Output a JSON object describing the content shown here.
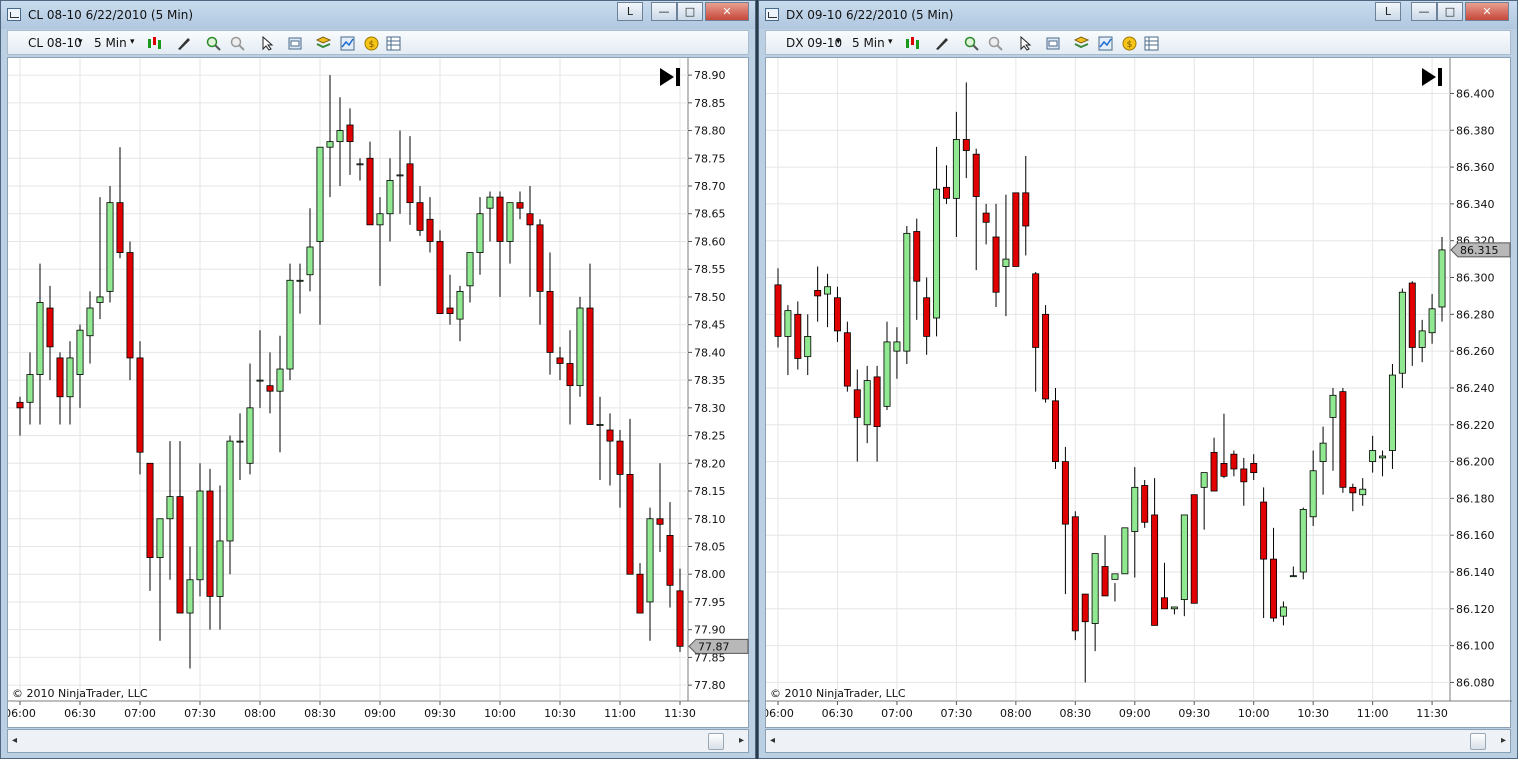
{
  "windows": [
    {
      "title": "CL 08-10  6/22/2010 (5 Min)",
      "buttons": {
        "l": "L",
        "min": "—",
        "max": "□",
        "close": "✕"
      },
      "toolbar": {
        "instrument": "CL 08-10",
        "interval": "5 Min"
      },
      "scroll": {
        "left": "◂",
        "right": "▸"
      },
      "copyright": "© 2010 NinjaTrader, LLC",
      "colors": {
        "up": "#90e890",
        "down": "#e00000",
        "grid": "#e6e6e6",
        "price_marker": "#b8b8b8"
      },
      "chart_data": {
        "type": "candlestick",
        "price_label": "77.87",
        "ylim": [
          77.775,
          78.92
        ],
        "y_ticks": [
          "78.90",
          "78.85",
          "78.80",
          "78.75",
          "78.70",
          "78.65",
          "78.60",
          "78.55",
          "78.50",
          "78.45",
          "78.40",
          "78.35",
          "78.30",
          "78.25",
          "78.20",
          "78.15",
          "78.10",
          "78.05",
          "78.00",
          "77.95",
          "77.90",
          "77.85",
          "77.80"
        ],
        "x_ticks": [
          "06:00",
          "06:30",
          "07:00",
          "07:30",
          "08:00",
          "08:30",
          "09:00",
          "09:30",
          "10:00",
          "10:30",
          "11:00",
          "11:30"
        ],
        "candles": [
          [
            78.31,
            78.32,
            78.25,
            78.3
          ],
          [
            78.31,
            78.4,
            78.27,
            78.36
          ],
          [
            78.36,
            78.56,
            78.27,
            78.49
          ],
          [
            78.48,
            78.52,
            78.35,
            78.41
          ],
          [
            78.39,
            78.4,
            78.27,
            78.32
          ],
          [
            78.32,
            78.42,
            78.27,
            78.39
          ],
          [
            78.36,
            78.45,
            78.3,
            78.44
          ],
          [
            78.43,
            78.51,
            78.38,
            78.48
          ],
          [
            78.49,
            78.68,
            78.46,
            78.5
          ],
          [
            78.51,
            78.7,
            78.49,
            78.67
          ],
          [
            78.67,
            78.77,
            78.57,
            78.58
          ],
          [
            78.58,
            78.6,
            78.35,
            78.39
          ],
          [
            78.39,
            78.42,
            78.18,
            78.22
          ],
          [
            78.2,
            78.2,
            77.97,
            78.03
          ],
          [
            78.03,
            78.07,
            77.88,
            78.1
          ],
          [
            78.1,
            78.24,
            77.99,
            78.14
          ],
          [
            78.14,
            78.24,
            77.93,
            77.93
          ],
          [
            77.93,
            78.05,
            77.83,
            77.99
          ],
          [
            77.99,
            78.2,
            77.96,
            78.15
          ],
          [
            78.15,
            78.19,
            77.9,
            77.96
          ],
          [
            77.96,
            78.16,
            77.9,
            78.06
          ],
          [
            78.06,
            78.25,
            78.0,
            78.24
          ],
          [
            78.24,
            78.29,
            78.17,
            78.24
          ],
          [
            78.2,
            78.38,
            78.18,
            78.3
          ],
          [
            78.35,
            78.44,
            78.3,
            78.35
          ],
          [
            78.34,
            78.4,
            78.29,
            78.33
          ],
          [
            78.33,
            78.43,
            78.22,
            78.37
          ],
          [
            78.37,
            78.56,
            78.35,
            78.53
          ],
          [
            78.53,
            78.56,
            78.47,
            78.53
          ],
          [
            78.54,
            78.66,
            78.51,
            78.59
          ],
          [
            78.6,
            78.76,
            78.45,
            78.77
          ],
          [
            78.77,
            78.9,
            78.68,
            78.78
          ],
          [
            78.78,
            78.86,
            78.7,
            78.8
          ],
          [
            78.81,
            78.84,
            78.72,
            78.78
          ],
          [
            78.74,
            78.75,
            78.71,
            78.74
          ],
          [
            78.75,
            78.78,
            78.66,
            78.63
          ],
          [
            78.63,
            78.68,
            78.52,
            78.65
          ],
          [
            78.65,
            78.75,
            78.6,
            78.71
          ],
          [
            78.72,
            78.8,
            78.65,
            78.72
          ],
          [
            78.74,
            78.79,
            78.63,
            78.67
          ],
          [
            78.67,
            78.7,
            78.61,
            78.62
          ],
          [
            78.64,
            78.68,
            78.58,
            78.6
          ],
          [
            78.6,
            78.62,
            78.47,
            78.47
          ],
          [
            78.48,
            78.54,
            78.45,
            78.47
          ],
          [
            78.46,
            78.52,
            78.42,
            78.51
          ],
          [
            78.52,
            78.56,
            78.49,
            78.58
          ],
          [
            78.58,
            78.68,
            78.54,
            78.65
          ],
          [
            78.66,
            78.69,
            78.6,
            78.68
          ],
          [
            78.68,
            78.69,
            78.5,
            78.6
          ],
          [
            78.6,
            78.67,
            78.56,
            78.67
          ],
          [
            78.67,
            78.69,
            78.64,
            78.66
          ],
          [
            78.65,
            78.7,
            78.5,
            78.63
          ],
          [
            78.63,
            78.64,
            78.45,
            78.51
          ],
          [
            78.51,
            78.58,
            78.36,
            78.4
          ],
          [
            78.39,
            78.41,
            78.35,
            78.38
          ],
          [
            78.38,
            78.44,
            78.27,
            78.34
          ],
          [
            78.34,
            78.5,
            78.32,
            78.48
          ],
          [
            78.48,
            78.56,
            78.3,
            78.27
          ],
          [
            78.27,
            78.32,
            78.17,
            78.27
          ],
          [
            78.26,
            78.29,
            78.16,
            78.24
          ],
          [
            78.24,
            78.26,
            78.12,
            78.18
          ],
          [
            78.18,
            78.28,
            78.13,
            78.0
          ],
          [
            78.0,
            78.02,
            77.95,
            77.93
          ],
          [
            77.95,
            78.12,
            77.88,
            78.1
          ],
          [
            78.1,
            78.2,
            78.04,
            78.09
          ],
          [
            78.07,
            78.13,
            77.94,
            77.98
          ],
          [
            77.97,
            78.01,
            77.86,
            77.87
          ]
        ]
      }
    },
    {
      "title": "DX 09-10  6/22/2010 (5 Min)",
      "buttons": {
        "l": "L",
        "min": "—",
        "max": "□",
        "close": "✕"
      },
      "toolbar": {
        "instrument": "DX 09-10",
        "interval": "5 Min"
      },
      "scroll": {
        "left": "◂",
        "right": "▸"
      },
      "copyright": "© 2010 NinjaTrader, LLC",
      "colors": {
        "up": "#90e890",
        "down": "#e00000",
        "grid": "#e6e6e6",
        "price_marker": "#b8b8b8"
      },
      "chart_data": {
        "type": "candlestick",
        "price_label": "86.315",
        "ylim": [
          86.071,
          86.416
        ],
        "y_ticks": [
          "86.400",
          "86.380",
          "86.360",
          "86.340",
          "86.320",
          "86.300",
          "86.280",
          "86.260",
          "86.240",
          "86.220",
          "86.200",
          "86.180",
          "86.160",
          "86.140",
          "86.120",
          "86.100",
          "86.080"
        ],
        "x_ticks": [
          "06:00",
          "06:30",
          "07:00",
          "07:30",
          "08:00",
          "08:30",
          "09:00",
          "09:30",
          "10:00",
          "10:30",
          "11:00",
          "11:30"
        ],
        "candles": [
          [
            86.296,
            86.305,
            86.262,
            86.268
          ],
          [
            86.268,
            86.285,
            86.247,
            86.282
          ],
          [
            86.28,
            86.287,
            86.25,
            86.256
          ],
          [
            86.257,
            86.28,
            86.247,
            86.268
          ],
          [
            86.293,
            86.306,
            86.276,
            86.29
          ],
          [
            86.291,
            86.302,
            86.273,
            86.295
          ],
          [
            86.289,
            86.295,
            86.265,
            86.271
          ],
          [
            86.27,
            86.276,
            86.238,
            86.241
          ],
          [
            86.239,
            86.25,
            86.2,
            86.224
          ],
          [
            86.22,
            86.252,
            86.21,
            86.244
          ],
          [
            86.246,
            86.252,
            86.2,
            86.219
          ],
          [
            86.23,
            86.276,
            86.228,
            86.265
          ],
          [
            86.26,
            86.273,
            86.245,
            86.265
          ],
          [
            86.26,
            86.328,
            86.253,
            86.324
          ],
          [
            86.325,
            86.332,
            86.277,
            86.298
          ],
          [
            86.289,
            86.3,
            86.258,
            86.268
          ],
          [
            86.278,
            86.371,
            86.268,
            86.348
          ],
          [
            86.349,
            86.361,
            86.34,
            86.343
          ],
          [
            86.343,
            86.39,
            86.322,
            86.375
          ],
          [
            86.375,
            86.406,
            86.354,
            86.369
          ],
          [
            86.367,
            86.37,
            86.304,
            86.344
          ],
          [
            86.335,
            86.34,
            86.318,
            86.33
          ],
          [
            86.322,
            86.34,
            86.284,
            86.292
          ],
          [
            86.306,
            86.345,
            86.279,
            86.31
          ],
          [
            86.346,
            86.346,
            86.325,
            86.306
          ],
          [
            86.346,
            86.366,
            86.312,
            86.328
          ],
          [
            86.302,
            86.303,
            86.238,
            86.262
          ],
          [
            86.28,
            86.285,
            86.232,
            86.234
          ],
          [
            86.233,
            86.24,
            86.196,
            86.2
          ],
          [
            86.2,
            86.208,
            86.128,
            86.166
          ],
          [
            86.17,
            86.173,
            86.103,
            86.108
          ],
          [
            86.128,
            86.12,
            86.08,
            86.113
          ],
          [
            86.112,
            86.15,
            86.097,
            86.15
          ],
          [
            86.143,
            86.16,
            86.13,
            86.127
          ],
          [
            86.136,
            86.134,
            86.124,
            86.139
          ],
          [
            86.139,
            86.163,
            86.14,
            86.164
          ],
          [
            86.162,
            86.197,
            86.137,
            86.186
          ],
          [
            86.187,
            86.19,
            86.164,
            86.167
          ],
          [
            86.171,
            86.191,
            86.12,
            86.111
          ],
          [
            86.126,
            86.145,
            86.122,
            86.12
          ],
          [
            86.12,
            86.12,
            86.117,
            86.121
          ],
          [
            86.125,
            86.17,
            86.116,
            86.171
          ],
          [
            86.182,
            86.182,
            86.124,
            86.123
          ],
          [
            86.186,
            86.192,
            86.163,
            86.194
          ],
          [
            86.205,
            86.213,
            86.185,
            86.184
          ],
          [
            86.199,
            86.226,
            86.191,
            86.192
          ],
          [
            86.204,
            86.206,
            86.192,
            86.196
          ],
          [
            86.196,
            86.202,
            86.176,
            86.189
          ],
          [
            86.199,
            86.204,
            86.19,
            86.194
          ],
          [
            86.178,
            86.186,
            86.115,
            86.147
          ],
          [
            86.147,
            86.164,
            86.113,
            86.115
          ],
          [
            86.116,
            86.124,
            86.111,
            86.121
          ],
          [
            86.138,
            86.143,
            86.138,
            86.138
          ],
          [
            86.14,
            86.175,
            86.136,
            86.174
          ],
          [
            86.17,
            86.206,
            86.165,
            86.195
          ],
          [
            86.2,
            86.219,
            86.182,
            86.21
          ],
          [
            86.224,
            86.24,
            86.195,
            86.236
          ],
          [
            86.238,
            86.24,
            86.183,
            86.186
          ],
          [
            86.186,
            86.188,
            86.173,
            86.183
          ],
          [
            86.182,
            86.191,
            86.176,
            86.185
          ],
          [
            86.2,
            86.214,
            86.194,
            86.206
          ],
          [
            86.202,
            86.206,
            86.192,
            86.203
          ],
          [
            86.206,
            86.253,
            86.196,
            86.247
          ],
          [
            86.248,
            86.294,
            86.24,
            86.292
          ],
          [
            86.297,
            86.298,
            86.252,
            86.262
          ],
          [
            86.262,
            86.277,
            86.254,
            86.271
          ],
          [
            86.27,
            86.291,
            86.264,
            86.283
          ],
          [
            86.284,
            86.322,
            86.276,
            86.315
          ]
        ]
      }
    }
  ]
}
